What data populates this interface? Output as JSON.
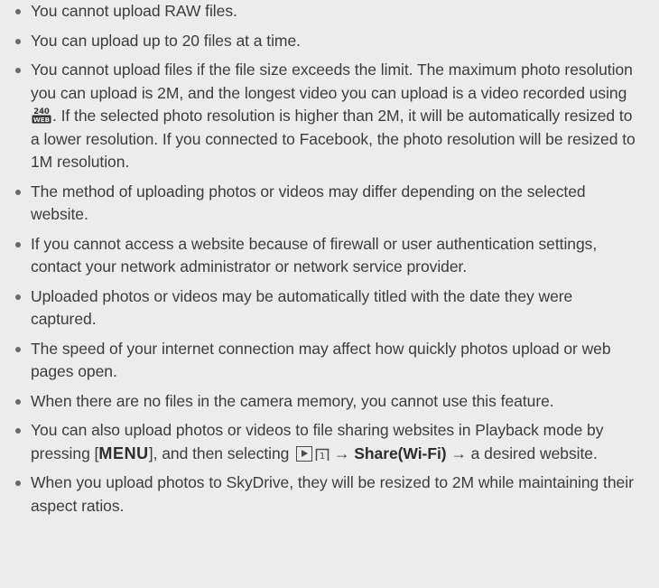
{
  "items": [
    {
      "text": "You cannot upload RAW files."
    },
    {
      "text": "You can upload up to 20 files at a time."
    },
    {
      "before_icon": "You cannot upload files if the file size exceeds the limit. The maximum photo resolution you can upload is 2M, and the longest video you can upload is a video recorded using ",
      "icon": "240-web-video-size-icon",
      "icon_text_top": "240",
      "icon_text_bottom": "WEB",
      "after_icon": ". If the selected photo resolution is higher than 2M, it will be automatically resized to a lower resolution. If you connected to Facebook, the photo resolution will be resized to 1M resolution."
    },
    {
      "text": "The method of uploading photos or videos may differ depending on the selected website."
    },
    {
      "text": "If you cannot access a website because of firewall or user authentication settings, contact your network administrator or network service provider."
    },
    {
      "text": "Uploaded photos or videos may be automatically titled with the date they were captured."
    },
    {
      "text": "The speed of your internet connection may affect how quickly photos upload or web pages open."
    },
    {
      "text": "When there are no files in the camera memory, you cannot use this feature."
    },
    {
      "part1": "You can also upload photos or videos to file sharing websites in Playback mode by pressing [",
      "menu_key": "MENU",
      "part2": "], and then selecting ",
      "icon_playback": "playback-icon",
      "icon_tab": "tab-1-icon",
      "tab_number": "1",
      "arrow1": " → ",
      "share_label": "Share(Wi-Fi)",
      "arrow2": " →",
      "part3": " a desired website."
    },
    {
      "text": "When you upload photos to SkyDrive, they will be resized to 2M while maintaining their aspect ratios."
    }
  ]
}
